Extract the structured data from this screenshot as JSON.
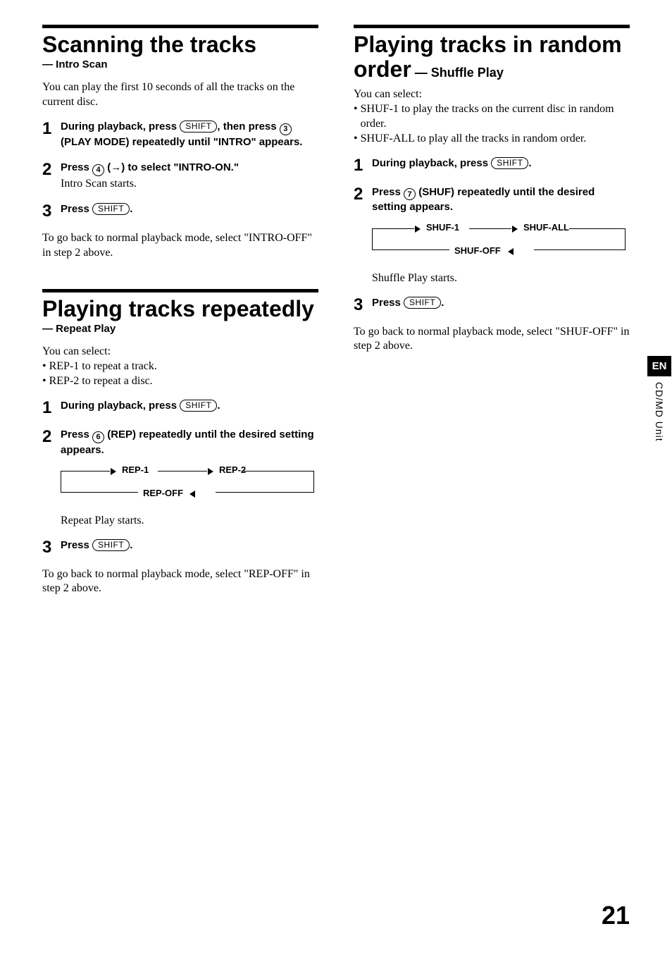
{
  "sections": {
    "scan": {
      "title": "Scanning the tracks",
      "subtitle": "— Intro Scan",
      "intro": "You can play the first 10 seconds of all the tracks on the current disc.",
      "step1_a": "During playback, press ",
      "step1_pill1": "SHIFT",
      "step1_b": ", then press ",
      "step1_num": "3",
      "step1_c": " (PLAY MODE) repeatedly until \"INTRO\" appears.",
      "step2_a": "Press ",
      "step2_num": "4",
      "step2_b": " (→) to select \"INTRO-ON.\"",
      "step2_plain": "Intro Scan starts.",
      "step3_a": "Press ",
      "step3_pill": "SHIFT",
      "step3_b": ".",
      "outro": "To go back to normal playback mode, select \"INTRO-OFF\" in step 2 above."
    },
    "repeat": {
      "title": "Playing tracks repeatedly",
      "subtitle": "— Repeat Play",
      "intro": "You can select:",
      "bullets": [
        "REP-1 to repeat a track.",
        "REP-2 to repeat a disc."
      ],
      "step1_a": "During playback, press ",
      "step1_pill": "SHIFT",
      "step1_b": ".",
      "step2_a": "Press ",
      "step2_num": "6",
      "step2_b": " (REP) repeatedly until the desired setting appears.",
      "cycle": {
        "a": "REP-1",
        "b": "REP-2",
        "off": "REP-OFF"
      },
      "step2_plain": "Repeat Play starts.",
      "step3_a": "Press ",
      "step3_pill": "SHIFT",
      "step3_b": ".",
      "outro": "To go back to normal playback mode, select \"REP-OFF\" in step 2 above."
    },
    "shuffle": {
      "title_a": "Playing tracks in random order",
      "title_sub": " — Shuffle Play",
      "intro": "You can select:",
      "bullets": [
        "SHUF-1 to play the tracks on the current disc in random order.",
        "SHUF-ALL to play all the tracks in random order."
      ],
      "step1_a": "During playback, press ",
      "step1_pill": "SHIFT",
      "step1_b": ".",
      "step2_a": "Press ",
      "step2_num": "7",
      "step2_b": " (SHUF) repeatedly until the desired setting appears.",
      "cycle": {
        "a": "SHUF-1",
        "b": "SHUF-ALL",
        "off": "SHUF-OFF"
      },
      "step2_plain": "Shuffle Play starts.",
      "step3_a": "Press ",
      "step3_pill": "SHIFT",
      "step3_b": ".",
      "outro": "To go back to normal playback mode, select \"SHUF-OFF\" in step 2 above."
    }
  },
  "sidebar": {
    "lang": "EN",
    "unit": "CD/MD Unit"
  },
  "page_number": "21",
  "nums": {
    "one": "1",
    "two": "2",
    "three": "3"
  }
}
